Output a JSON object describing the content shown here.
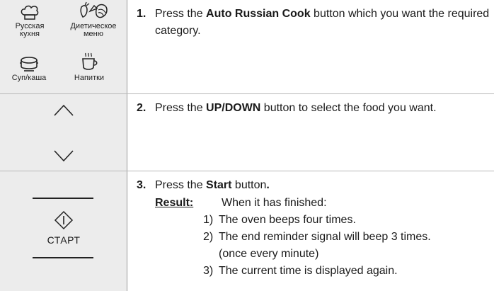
{
  "steps": [
    {
      "number": "1.",
      "pre": "Press the ",
      "bold": "Auto Russian Cook",
      "post": " button which you want the required category."
    },
    {
      "number": "2.",
      "pre": "Press the ",
      "bold": "UP/DOWN",
      "post": " button to select the food you want."
    },
    {
      "number": "3.",
      "pre": "Press the ",
      "bold": "Start",
      "post": " button",
      "post_bold": "."
    }
  ],
  "categories": [
    {
      "label_line1": "Русская",
      "label_line2": "кухня",
      "icon": "chef-hat-icon"
    },
    {
      "label_line1": "Диетическое",
      "label_line2": "меню",
      "icon": "vegetables-icon"
    },
    {
      "label_line1": "Суп/каша",
      "label_line2": "",
      "icon": "soup-pot-icon"
    },
    {
      "label_line1": "Напитки",
      "label_line2": "",
      "icon": "hot-cup-icon"
    }
  ],
  "start_button_label": "СТАРТ",
  "result": {
    "label": "Result:",
    "intro": "When it has finished:",
    "items": [
      {
        "num": "1)",
        "text": "The oven beeps four times."
      },
      {
        "num": "2)",
        "text": "The end reminder signal will beep 3 times."
      },
      {
        "num": "",
        "text": "(once every minute)"
      },
      {
        "num": "3)",
        "text": "The current time is displayed again."
      }
    ]
  },
  "icons": {
    "up": "chevron-up-icon",
    "down": "chevron-down-icon",
    "start": "start-diamond-icon"
  },
  "colors": {
    "left_panel_bg": "#ececec",
    "divider": "#b8b8b8",
    "text": "#1a1a1a"
  }
}
